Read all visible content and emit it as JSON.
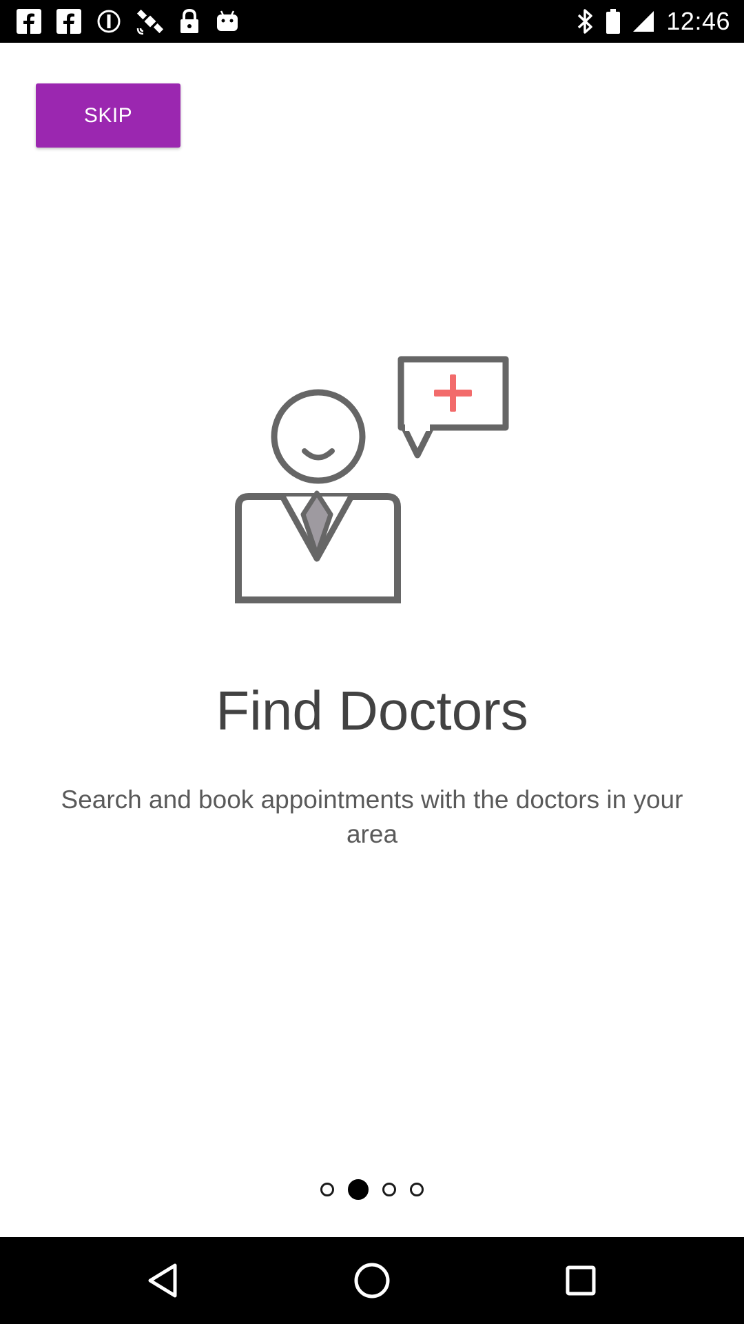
{
  "status_bar": {
    "time": "12:46",
    "left_icons": [
      "facebook-icon",
      "facebook-icon",
      "disabled-icon",
      "satellite-icon",
      "lock-icon",
      "android-icon"
    ],
    "right_icons": [
      "bluetooth-icon",
      "battery-icon",
      "signal-icon"
    ]
  },
  "onboarding": {
    "skip_label": "SKIP",
    "title": "Find Doctors",
    "description": "Search and book appointments with the doctors in your area",
    "pages": 4,
    "current_page": 2
  },
  "nav_bar": {
    "buttons": [
      "back-icon",
      "home-icon",
      "recents-icon"
    ]
  },
  "colors": {
    "accent": "#9b27b0",
    "icon_gray": "#666666",
    "plus_red": "#f26b6b",
    "title_text": "#424242"
  }
}
